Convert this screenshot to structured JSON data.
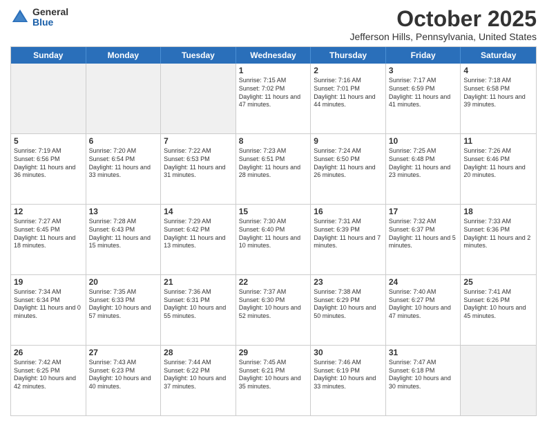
{
  "header": {
    "logo_general": "General",
    "logo_blue": "Blue",
    "month_title": "October 2025",
    "location": "Jefferson Hills, Pennsylvania, United States"
  },
  "days_of_week": [
    "Sunday",
    "Monday",
    "Tuesday",
    "Wednesday",
    "Thursday",
    "Friday",
    "Saturday"
  ],
  "weeks": [
    [
      {
        "day": "",
        "text": "",
        "shaded": true
      },
      {
        "day": "",
        "text": "",
        "shaded": true
      },
      {
        "day": "",
        "text": "",
        "shaded": true
      },
      {
        "day": "1",
        "text": "Sunrise: 7:15 AM\nSunset: 7:02 PM\nDaylight: 11 hours and 47 minutes."
      },
      {
        "day": "2",
        "text": "Sunrise: 7:16 AM\nSunset: 7:01 PM\nDaylight: 11 hours and 44 minutes."
      },
      {
        "day": "3",
        "text": "Sunrise: 7:17 AM\nSunset: 6:59 PM\nDaylight: 11 hours and 41 minutes."
      },
      {
        "day": "4",
        "text": "Sunrise: 7:18 AM\nSunset: 6:58 PM\nDaylight: 11 hours and 39 minutes."
      }
    ],
    [
      {
        "day": "5",
        "text": "Sunrise: 7:19 AM\nSunset: 6:56 PM\nDaylight: 11 hours and 36 minutes."
      },
      {
        "day": "6",
        "text": "Sunrise: 7:20 AM\nSunset: 6:54 PM\nDaylight: 11 hours and 33 minutes."
      },
      {
        "day": "7",
        "text": "Sunrise: 7:22 AM\nSunset: 6:53 PM\nDaylight: 11 hours and 31 minutes."
      },
      {
        "day": "8",
        "text": "Sunrise: 7:23 AM\nSunset: 6:51 PM\nDaylight: 11 hours and 28 minutes."
      },
      {
        "day": "9",
        "text": "Sunrise: 7:24 AM\nSunset: 6:50 PM\nDaylight: 11 hours and 26 minutes."
      },
      {
        "day": "10",
        "text": "Sunrise: 7:25 AM\nSunset: 6:48 PM\nDaylight: 11 hours and 23 minutes."
      },
      {
        "day": "11",
        "text": "Sunrise: 7:26 AM\nSunset: 6:46 PM\nDaylight: 11 hours and 20 minutes."
      }
    ],
    [
      {
        "day": "12",
        "text": "Sunrise: 7:27 AM\nSunset: 6:45 PM\nDaylight: 11 hours and 18 minutes."
      },
      {
        "day": "13",
        "text": "Sunrise: 7:28 AM\nSunset: 6:43 PM\nDaylight: 11 hours and 15 minutes."
      },
      {
        "day": "14",
        "text": "Sunrise: 7:29 AM\nSunset: 6:42 PM\nDaylight: 11 hours and 13 minutes."
      },
      {
        "day": "15",
        "text": "Sunrise: 7:30 AM\nSunset: 6:40 PM\nDaylight: 11 hours and 10 minutes."
      },
      {
        "day": "16",
        "text": "Sunrise: 7:31 AM\nSunset: 6:39 PM\nDaylight: 11 hours and 7 minutes."
      },
      {
        "day": "17",
        "text": "Sunrise: 7:32 AM\nSunset: 6:37 PM\nDaylight: 11 hours and 5 minutes."
      },
      {
        "day": "18",
        "text": "Sunrise: 7:33 AM\nSunset: 6:36 PM\nDaylight: 11 hours and 2 minutes."
      }
    ],
    [
      {
        "day": "19",
        "text": "Sunrise: 7:34 AM\nSunset: 6:34 PM\nDaylight: 11 hours and 0 minutes."
      },
      {
        "day": "20",
        "text": "Sunrise: 7:35 AM\nSunset: 6:33 PM\nDaylight: 10 hours and 57 minutes."
      },
      {
        "day": "21",
        "text": "Sunrise: 7:36 AM\nSunset: 6:31 PM\nDaylight: 10 hours and 55 minutes."
      },
      {
        "day": "22",
        "text": "Sunrise: 7:37 AM\nSunset: 6:30 PM\nDaylight: 10 hours and 52 minutes."
      },
      {
        "day": "23",
        "text": "Sunrise: 7:38 AM\nSunset: 6:29 PM\nDaylight: 10 hours and 50 minutes."
      },
      {
        "day": "24",
        "text": "Sunrise: 7:40 AM\nSunset: 6:27 PM\nDaylight: 10 hours and 47 minutes."
      },
      {
        "day": "25",
        "text": "Sunrise: 7:41 AM\nSunset: 6:26 PM\nDaylight: 10 hours and 45 minutes."
      }
    ],
    [
      {
        "day": "26",
        "text": "Sunrise: 7:42 AM\nSunset: 6:25 PM\nDaylight: 10 hours and 42 minutes."
      },
      {
        "day": "27",
        "text": "Sunrise: 7:43 AM\nSunset: 6:23 PM\nDaylight: 10 hours and 40 minutes."
      },
      {
        "day": "28",
        "text": "Sunrise: 7:44 AM\nSunset: 6:22 PM\nDaylight: 10 hours and 37 minutes."
      },
      {
        "day": "29",
        "text": "Sunrise: 7:45 AM\nSunset: 6:21 PM\nDaylight: 10 hours and 35 minutes."
      },
      {
        "day": "30",
        "text": "Sunrise: 7:46 AM\nSunset: 6:19 PM\nDaylight: 10 hours and 33 minutes."
      },
      {
        "day": "31",
        "text": "Sunrise: 7:47 AM\nSunset: 6:18 PM\nDaylight: 10 hours and 30 minutes."
      },
      {
        "day": "",
        "text": "",
        "shaded": true
      }
    ]
  ]
}
